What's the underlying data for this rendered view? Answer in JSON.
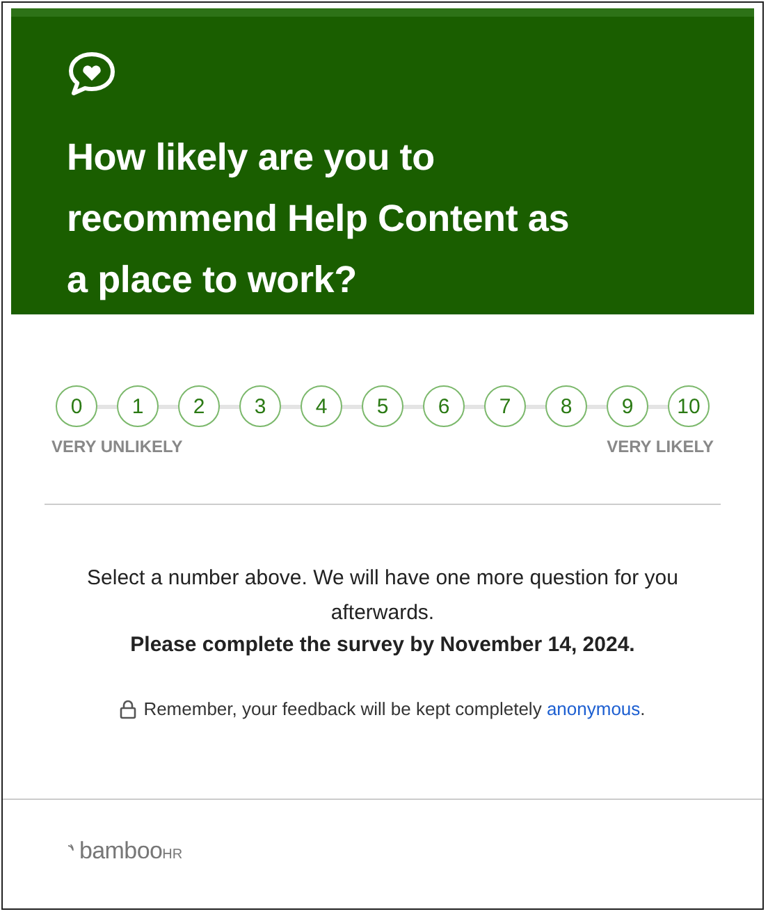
{
  "header": {
    "title": "How likely are you to recommend Help Content as a place to work?"
  },
  "scale": {
    "options": [
      {
        "label": "0",
        "selected": false
      },
      {
        "label": "1",
        "selected": false
      },
      {
        "label": "2",
        "selected": false
      },
      {
        "label": "3",
        "selected": false
      },
      {
        "label": "4",
        "selected": false
      },
      {
        "label": "5",
        "selected": false
      },
      {
        "label": "6",
        "selected": false
      },
      {
        "label": "7",
        "selected": false
      },
      {
        "label": "8",
        "selected": false
      },
      {
        "label": "9",
        "selected": false
      },
      {
        "label": "10",
        "selected": false
      }
    ],
    "low_label": "VERY UNLIKELY",
    "high_label": "VERY LIKELY"
  },
  "instructions": "Select a number above. We will have one more question for you afterwards.",
  "deadline": "Please complete the survey by November 14, 2024.",
  "privacy": {
    "text": "Remember, your feedback will be kept completely",
    "link": "anonymous",
    "end": "."
  },
  "footer": {
    "logo": "bamboo",
    "logo_suffix": "HR"
  }
}
